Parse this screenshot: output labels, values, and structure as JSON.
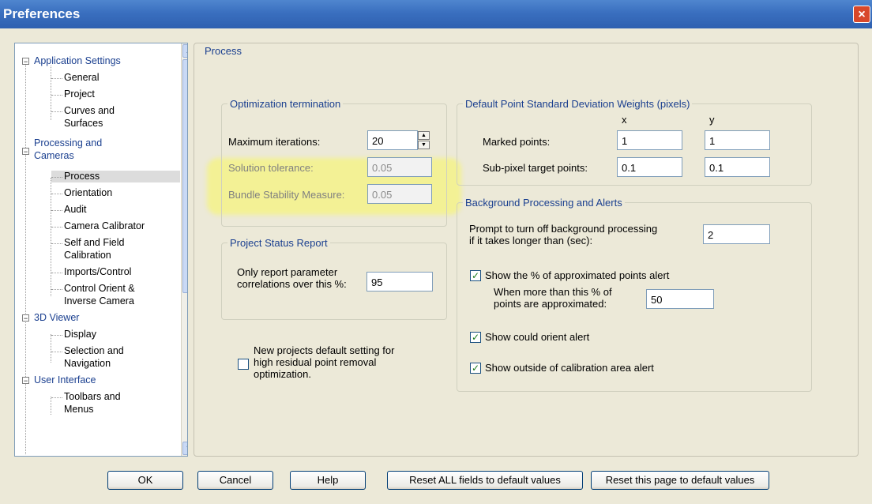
{
  "window": {
    "title": "Preferences",
    "close_glyph": "×"
  },
  "tree": {
    "items": [
      {
        "label": "Application Settings",
        "level": 0,
        "expander": "−"
      },
      {
        "label": "General",
        "level": 1
      },
      {
        "label": "Project",
        "level": 1
      },
      {
        "label": "Curves and",
        "level": 1
      },
      {
        "label": "Surfaces",
        "level": 1
      },
      {
        "label": "Processing and",
        "level": 0,
        "expander": "−"
      },
      {
        "label": "Cameras",
        "level": 0
      },
      {
        "label": "Process",
        "level": 1,
        "selected": true
      },
      {
        "label": "Orientation",
        "level": 1
      },
      {
        "label": "Audit",
        "level": 1
      },
      {
        "label": "Camera Calibrator",
        "level": 1
      },
      {
        "label": "Self and Field",
        "level": 1
      },
      {
        "label": "Calibration",
        "level": 1
      },
      {
        "label": "Imports/Control",
        "level": 1
      },
      {
        "label": "Control Orient &",
        "level": 1
      },
      {
        "label": "Inverse Camera",
        "level": 1
      },
      {
        "label": "3D Viewer",
        "level": 0,
        "expander": "−"
      },
      {
        "label": "Display",
        "level": 1
      },
      {
        "label": "Selection and",
        "level": 1
      },
      {
        "label": "Navigation",
        "level": 1
      },
      {
        "label": "User Interface",
        "level": 0,
        "expander": "−"
      },
      {
        "label": "Toolbars and",
        "level": 1
      },
      {
        "label": "Menus",
        "level": 1
      }
    ],
    "scroll_up": "▲",
    "scroll_down": "▼"
  },
  "page": {
    "title": "Process",
    "optimization": {
      "title": "Optimization termination",
      "max_iter_label": "Maximum iterations:",
      "max_iter_value": "20",
      "tolerance_label": "Solution tolerance:",
      "tolerance_value": "0.05",
      "bundle_label": "Bundle Stability Measure:",
      "bundle_value": "0.05"
    },
    "weights": {
      "title": "Default Point Standard Deviation Weights (pixels)",
      "col_x": "x",
      "col_y": "y",
      "marked_label": "Marked points:",
      "marked_x": "1",
      "marked_y": "1",
      "subpixel_label": "Sub-pixel target points:",
      "subpixel_x": "0.1",
      "subpixel_y": "0.1"
    },
    "status_report": {
      "title": "Project Status Report",
      "label_line1": "Only report parameter",
      "label_line2": "correlations over this %:",
      "value": "95"
    },
    "background": {
      "title": "Background Processing and Alerts",
      "prompt_line1": "Prompt to turn off background processing",
      "prompt_line2": "if it takes longer than (sec):",
      "prompt_value": "2",
      "approx_alert_label": "Show the % of approximated points alert",
      "approx_alert_checked": true,
      "approx_line1": "When more than this % of",
      "approx_line2": "points are approximated:",
      "approx_value": "50",
      "orient_alert_label": "Show could orient alert",
      "orient_alert_checked": true,
      "calib_alert_label": "Show outside of calibration area alert",
      "calib_alert_checked": true
    },
    "residual": {
      "line1": "New projects default setting for",
      "line2": "high residual point removal",
      "line3": "optimization.",
      "checked": false
    }
  },
  "buttons": {
    "ok": "OK",
    "cancel": "Cancel",
    "help": "Help",
    "reset_all": "Reset ALL fields to default values",
    "reset_page": "Reset this page to default values"
  },
  "colors": {
    "titlebar": "#3a6fbf",
    "group_label": "#1a3f8f",
    "highlight": "#ffff28"
  }
}
